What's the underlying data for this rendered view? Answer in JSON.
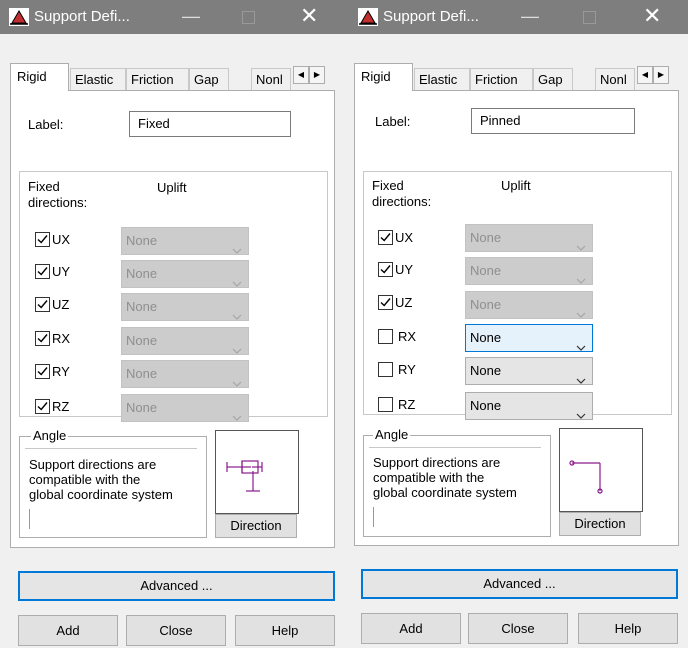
{
  "windows": [
    {
      "title": "Support Defi...",
      "tabs": [
        "Rigid",
        "Elastic",
        "Friction",
        "Gap",
        "Nonl"
      ],
      "label_caption": "Label:",
      "label_value": "Fixed",
      "fixed_caption": "Fixed directions:",
      "fixed_caption_line1": "Fixed",
      "fixed_caption_line2": "directions:",
      "uplift_caption": "Uplift",
      "directions": [
        {
          "name": "UX",
          "checked": true,
          "uplift": "None",
          "enabled": false
        },
        {
          "name": "UY",
          "checked": true,
          "uplift": "None",
          "enabled": false
        },
        {
          "name": "UZ",
          "checked": true,
          "uplift": "None",
          "enabled": false
        },
        {
          "name": "RX",
          "checked": true,
          "uplift": "None",
          "enabled": false
        },
        {
          "name": "RY",
          "checked": true,
          "uplift": "None",
          "enabled": false
        },
        {
          "name": "RZ",
          "checked": true,
          "uplift": "None",
          "enabled": false
        }
      ],
      "angle_caption": "Angle",
      "angle_text": [
        "Support directions are",
        "compatible with the",
        "global coordinate system"
      ],
      "direction_button": "Direction",
      "advanced_button": "Advanced ...",
      "add_button": "Add",
      "close_button": "Close",
      "help_button": "Help"
    },
    {
      "title": "Support Defi...",
      "tabs": [
        "Rigid",
        "Elastic",
        "Friction",
        "Gap",
        "Nonl"
      ],
      "label_caption": "Label:",
      "label_value": "Pinned",
      "fixed_caption": "Fixed directions:",
      "fixed_caption_line1": "Fixed",
      "fixed_caption_line2": "directions:",
      "uplift_caption": "Uplift",
      "directions": [
        {
          "name": "UX",
          "checked": true,
          "uplift": "None",
          "enabled": false
        },
        {
          "name": "UY",
          "checked": true,
          "uplift": "None",
          "enabled": false
        },
        {
          "name": "UZ",
          "checked": true,
          "uplift": "None",
          "enabled": false
        },
        {
          "name": "RX",
          "checked": false,
          "uplift": "None",
          "enabled": true,
          "focused": true
        },
        {
          "name": "RY",
          "checked": false,
          "uplift": "None",
          "enabled": true
        },
        {
          "name": "RZ",
          "checked": false,
          "uplift": "None",
          "enabled": true
        }
      ],
      "angle_caption": "Angle",
      "angle_text": [
        "Support directions are",
        "compatible with the",
        "global coordinate system"
      ],
      "direction_button": "Direction",
      "advanced_button": "Advanced ...",
      "add_button": "Add",
      "close_button": "Close",
      "help_button": "Help"
    }
  ],
  "icons": {
    "app": "support-app-icon",
    "minimize": "minimize-icon",
    "maximize": "maximize-icon",
    "close": "close-icon",
    "tab_left": "scroll-left-icon",
    "tab_right": "scroll-right-icon",
    "combo": "chevron-down-icon",
    "fixed_symbol": "fixed-support-symbol-icon",
    "pinned_symbol": "pinned-support-symbol-icon"
  },
  "colors": {
    "titlebar": "#7e7e7e",
    "dialog": "#f0f0f0",
    "accent": "#0078d7",
    "symbol": "#8b1a8b"
  }
}
